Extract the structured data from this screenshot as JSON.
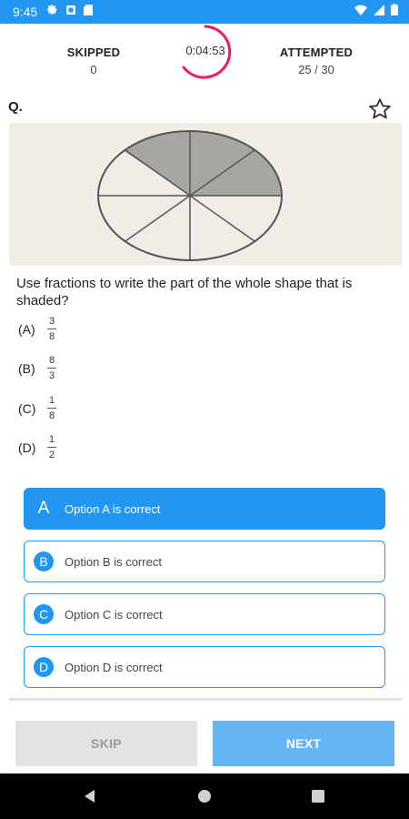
{
  "status_bar": {
    "time": "9:45"
  },
  "header": {
    "skipped_label": "SKIPPED",
    "skipped_value": "0",
    "timer": "0:04:53",
    "attempted_label": "ATTEMPTED",
    "attempted_value": "25 / 30"
  },
  "question": {
    "label": "Q.",
    "text": "Use fractions to write the part of the whole shape that is shaded?",
    "options": [
      {
        "label": "(A)",
        "numerator": "3",
        "denominator": "8"
      },
      {
        "label": "(B)",
        "numerator": "8",
        "denominator": "3"
      },
      {
        "label": "(C)",
        "numerator": "1",
        "denominator": "8"
      },
      {
        "label": "(D)",
        "numerator": "1",
        "denominator": "2"
      }
    ]
  },
  "choices": [
    {
      "letter": "A",
      "text": "Option A is correct",
      "selected": true
    },
    {
      "letter": "B",
      "text": "Option B is correct",
      "selected": false
    },
    {
      "letter": "C",
      "text": "Option C is correct",
      "selected": false
    },
    {
      "letter": "D",
      "text": "Option D is correct",
      "selected": false
    }
  ],
  "footer": {
    "skip_label": "SKIP",
    "next_label": "NEXT"
  },
  "colors": {
    "accent": "#2196f3",
    "timer_ring": "#e91e63",
    "next_button": "#64b5f6"
  },
  "icons": [
    "settings-icon",
    "notification-icon",
    "sd-card-icon",
    "wifi-icon",
    "signal-icon",
    "battery-icon",
    "star-outline-icon",
    "back-icon",
    "home-icon",
    "recents-icon"
  ]
}
